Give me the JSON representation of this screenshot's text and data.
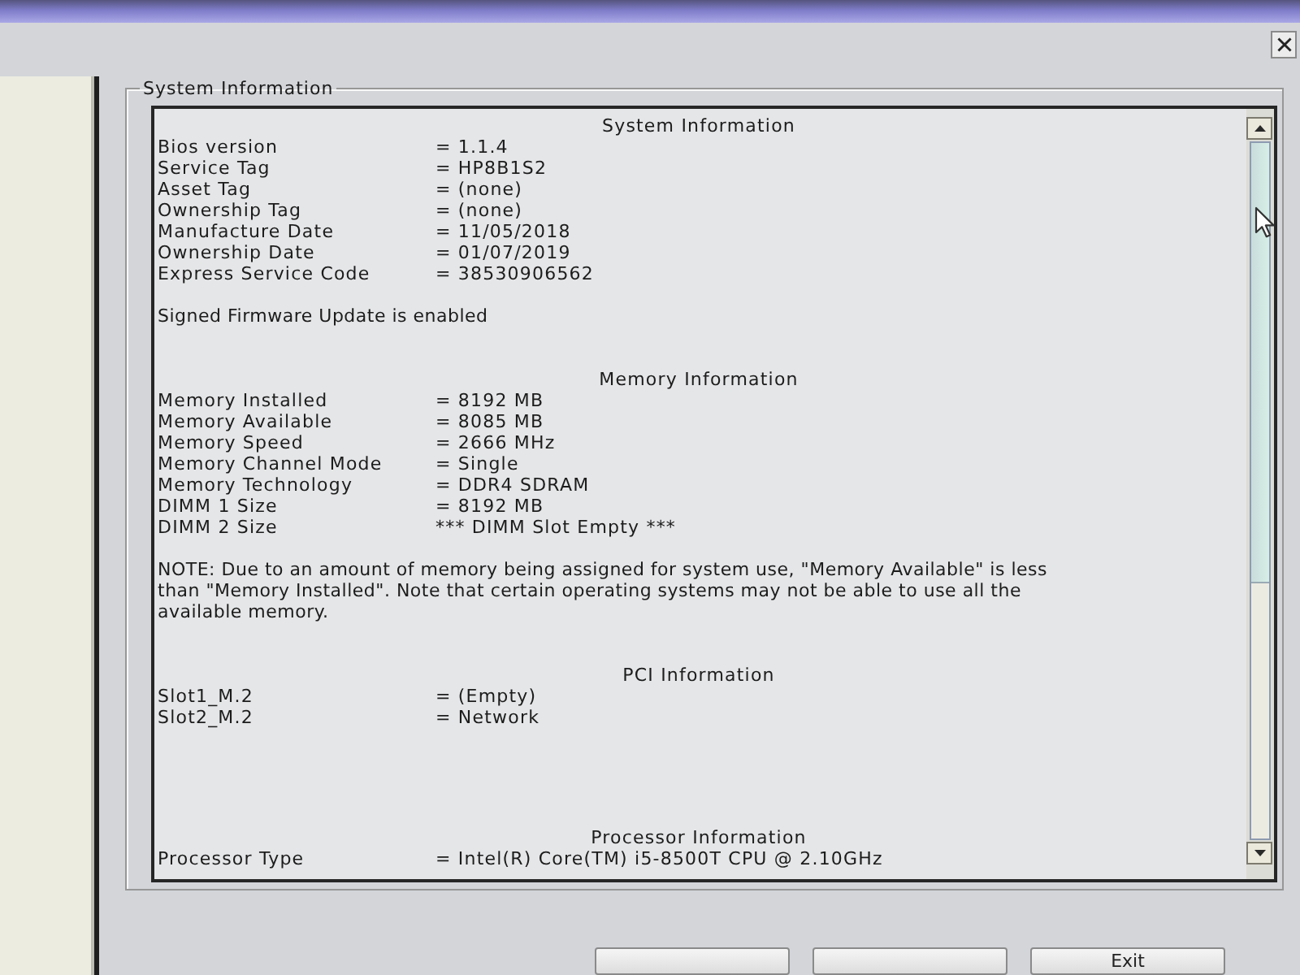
{
  "group": {
    "title": "System Information"
  },
  "sections": [
    {
      "heading": "System Information",
      "rows": [
        {
          "label": "Bios version",
          "value": "= 1.1.4"
        },
        {
          "label": "Service Tag",
          "value": "= HP8B1S2"
        },
        {
          "label": "Asset Tag",
          "value": "= (none)"
        },
        {
          "label": "Ownership Tag",
          "value": "= (none)"
        },
        {
          "label": "Manufacture Date",
          "value": "= 11/05/2018"
        },
        {
          "label": "Ownership Date",
          "value": "= 01/07/2019"
        },
        {
          "label": "Express Service Code",
          "value": "= 38530906562"
        }
      ],
      "notes": [
        "Signed Firmware Update is enabled"
      ]
    },
    {
      "heading": "Memory Information",
      "rows": [
        {
          "label": "Memory Installed",
          "value": "= 8192 MB"
        },
        {
          "label": "Memory Available",
          "value": "= 8085 MB"
        },
        {
          "label": "Memory Speed",
          "value": "= 2666 MHz"
        },
        {
          "label": "Memory Channel Mode",
          "value": "= Single"
        },
        {
          "label": "Memory Technology",
          "value": "= DDR4 SDRAM"
        },
        {
          "label": "DIMM 1 Size",
          "value": "= 8192 MB"
        },
        {
          "label": "DIMM 2 Size",
          "value": "*** DIMM Slot Empty ***"
        }
      ],
      "notes": [
        "NOTE: Due to an amount of memory being assigned for system use, \"Memory Available\" is less than \"Memory Installed\". Note that certain operating systems may not be able to use all the available memory."
      ]
    },
    {
      "heading": "PCI Information",
      "rows": [
        {
          "label": "Slot1_M.2",
          "value": "= (Empty)"
        },
        {
          "label": "Slot2_M.2",
          "value": "= Network"
        }
      ]
    },
    {
      "heading": "Processor Information",
      "rows": [
        {
          "label": "Processor Type",
          "value": "= Intel(R) Core(TM) i5-8500T CPU @ 2.10GHz"
        }
      ]
    }
  ],
  "buttons": [
    {
      "kind": "blank"
    },
    {
      "kind": "blank"
    },
    {
      "kind": "labeled",
      "label": "Exit"
    }
  ]
}
